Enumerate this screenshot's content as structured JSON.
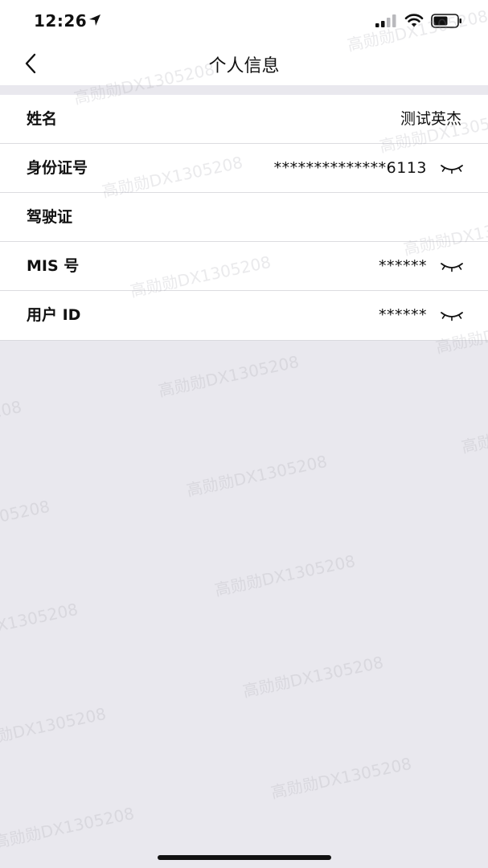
{
  "status_bar": {
    "time": "12:26",
    "icons": [
      "location-arrow-icon",
      "cellular-signal-icon",
      "wifi-icon",
      "battery-icon"
    ]
  },
  "nav": {
    "back_icon": "chevron-left-icon",
    "title": "个人信息"
  },
  "rows": [
    {
      "label": "姓名",
      "value": "测试英杰"
    },
    {
      "label": "身份证号",
      "value": "**************6113",
      "icon": "eye-closed-icon"
    },
    {
      "label": "驾驶证",
      "value": ""
    },
    {
      "label": "MIS 号",
      "value": "******",
      "icon": "eye-closed-icon"
    },
    {
      "label": "用户 ID",
      "value": "******",
      "icon": "eye-closed-icon"
    }
  ],
  "watermark": "高勋勋DX1305208",
  "colors": {
    "background": "#e9e8ee",
    "surface": "#ffffff",
    "text": "#111111",
    "divider": "#dcdce0"
  }
}
